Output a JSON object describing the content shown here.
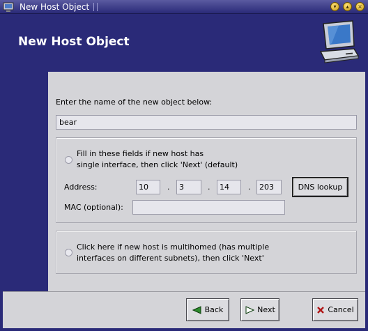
{
  "window": {
    "title": "New Host Object",
    "icons": [
      "window-icon",
      "minimize-icon",
      "maximize-icon",
      "close-icon"
    ]
  },
  "header": {
    "title": "New Host Object",
    "icon": "computer-icon"
  },
  "form": {
    "prompt": "Enter the name of the new object below:",
    "name_value": "bear",
    "option_single_line1": "Fill in these fields if new host has",
    "option_single_line2": "single interface, then click 'Next' (default)",
    "address_label": "Address:",
    "address_octets": [
      "10",
      "3",
      "14",
      "203"
    ],
    "address_separator": ".",
    "dns_button": "DNS lookup",
    "mac_label": "MAC (optional):",
    "mac_value": "",
    "option_multi_line1": "Click here if new host is multihomed (has multiple",
    "option_multi_line2": "interfaces on different subnets), then click 'Next'"
  },
  "footer": {
    "back_label": "Back",
    "next_label": "Next",
    "cancel_label": "Cancel"
  },
  "colors": {
    "header_bg": "#2a2a78",
    "panel_bg": "#d4d4d8",
    "back_arrow": "#2e8b2e",
    "cancel_x": "#b01818"
  }
}
